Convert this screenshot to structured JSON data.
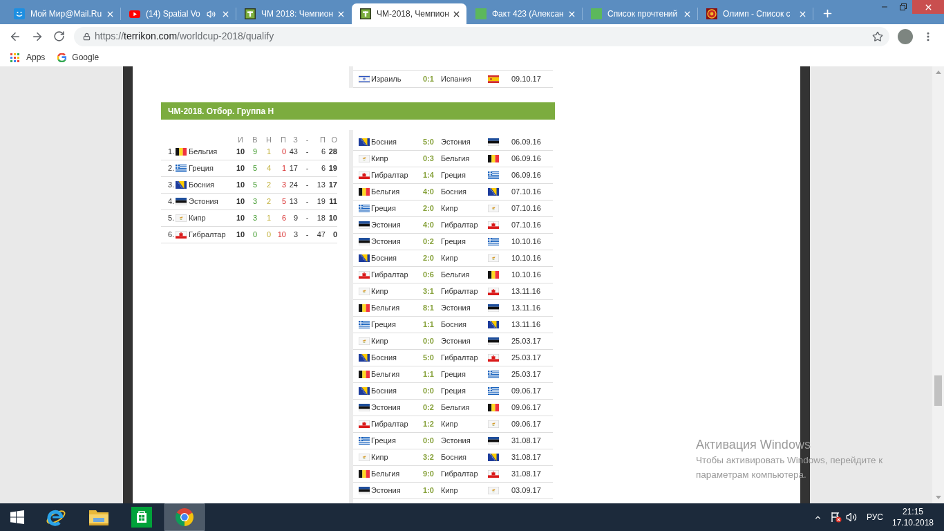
{
  "browser": {
    "tabs": [
      {
        "kind": "mail",
        "title": "Мой Мир@Mail.Ru",
        "audio": false,
        "selected": false
      },
      {
        "kind": "youtube",
        "title": "(14) Spatial Vo",
        "audio": true,
        "selected": false
      },
      {
        "kind": "terrikon",
        "title": "ЧМ 2018: Чемпион",
        "audio": false,
        "selected": false
      },
      {
        "kind": "terrikon",
        "title": "ЧМ-2018, Чемпион",
        "audio": false,
        "selected": true
      },
      {
        "kind": "square",
        "title": "Факт 423 (Алексан",
        "audio": false,
        "selected": false
      },
      {
        "kind": "square",
        "title": "Список прочтений",
        "audio": false,
        "selected": false
      },
      {
        "kind": "emblem",
        "title": "Олимп - Список с",
        "audio": false,
        "selected": false
      }
    ],
    "url": {
      "scheme": "https://",
      "host": "terrikon.com",
      "path": "/worldcup-2018/qualify"
    },
    "bookmarks": [
      {
        "kind": "apps",
        "label": "Apps"
      },
      {
        "kind": "google",
        "label": "Google"
      }
    ]
  },
  "page": {
    "previous_match": {
      "home": {
        "kind": "israel",
        "name": "Израиль"
      },
      "score": "0:1",
      "away": {
        "kind": "spain",
        "name": "Испания"
      },
      "date": "09.10.17"
    },
    "group": {
      "title": "ЧМ-2018. Отбор. Группа Н",
      "standings": {
        "columns": [
          "И",
          "В",
          "Н",
          "П",
          "З",
          "-",
          "П",
          "О"
        ],
        "rows": [
          {
            "rank": "1.",
            "team": {
              "kind": "belgium",
              "name": "Бельгия"
            },
            "played": "10",
            "won": "9",
            "drawn": "1",
            "lost": "0",
            "goals_for": "43",
            "separator": "-",
            "goals_against": "6",
            "points": "28"
          },
          {
            "rank": "2.",
            "team": {
              "kind": "greece",
              "name": "Греция"
            },
            "played": "10",
            "won": "5",
            "drawn": "4",
            "lost": "1",
            "goals_for": "17",
            "separator": "-",
            "goals_against": "6",
            "points": "19"
          },
          {
            "rank": "3.",
            "team": {
              "kind": "bosnia",
              "name": "Босния"
            },
            "played": "10",
            "won": "5",
            "drawn": "2",
            "lost": "3",
            "goals_for": "24",
            "separator": "-",
            "goals_against": "13",
            "points": "17"
          },
          {
            "rank": "4.",
            "team": {
              "kind": "estonia",
              "name": "Эстония"
            },
            "played": "10",
            "won": "3",
            "drawn": "2",
            "lost": "5",
            "goals_for": "13",
            "separator": "-",
            "goals_against": "19",
            "points": "11"
          },
          {
            "rank": "5.",
            "team": {
              "kind": "cyprus",
              "name": "Кипр"
            },
            "played": "10",
            "won": "3",
            "drawn": "1",
            "lost": "6",
            "goals_for": "9",
            "separator": "-",
            "goals_against": "18",
            "points": "10"
          },
          {
            "rank": "6.",
            "team": {
              "kind": "gibraltar",
              "name": "Гибралтар"
            },
            "played": "10",
            "won": "0",
            "drawn": "0",
            "lost": "10",
            "goals_for": "3",
            "separator": "-",
            "goals_against": "47",
            "points": "0"
          }
        ]
      },
      "matches": [
        {
          "home": {
            "kind": "bosnia",
            "name": "Босния"
          },
          "score": "5:0",
          "away": {
            "kind": "estonia",
            "name": "Эстония"
          },
          "date": "06.09.16"
        },
        {
          "home": {
            "kind": "cyprus",
            "name": "Кипр"
          },
          "score": "0:3",
          "away": {
            "kind": "belgium",
            "name": "Бельгия"
          },
          "date": "06.09.16"
        },
        {
          "home": {
            "kind": "gibraltar",
            "name": "Гибралтар"
          },
          "score": "1:4",
          "away": {
            "kind": "greece",
            "name": "Греция"
          },
          "date": "06.09.16"
        },
        {
          "home": {
            "kind": "belgium",
            "name": "Бельгия"
          },
          "score": "4:0",
          "away": {
            "kind": "bosnia",
            "name": "Босния"
          },
          "date": "07.10.16"
        },
        {
          "home": {
            "kind": "greece",
            "name": "Греция"
          },
          "score": "2:0",
          "away": {
            "kind": "cyprus",
            "name": "Кипр"
          },
          "date": "07.10.16"
        },
        {
          "home": {
            "kind": "estonia",
            "name": "Эстония"
          },
          "score": "4:0",
          "away": {
            "kind": "gibraltar",
            "name": "Гибралтар"
          },
          "date": "07.10.16"
        },
        {
          "home": {
            "kind": "estonia",
            "name": "Эстония"
          },
          "score": "0:2",
          "away": {
            "kind": "greece",
            "name": "Греция"
          },
          "date": "10.10.16"
        },
        {
          "home": {
            "kind": "bosnia",
            "name": "Босния"
          },
          "score": "2:0",
          "away": {
            "kind": "cyprus",
            "name": "Кипр"
          },
          "date": "10.10.16"
        },
        {
          "home": {
            "kind": "gibraltar",
            "name": "Гибралтар"
          },
          "score": "0:6",
          "away": {
            "kind": "belgium",
            "name": "Бельгия"
          },
          "date": "10.10.16"
        },
        {
          "home": {
            "kind": "cyprus",
            "name": "Кипр"
          },
          "score": "3:1",
          "away": {
            "kind": "gibraltar",
            "name": "Гибралтар"
          },
          "date": "13.11.16"
        },
        {
          "home": {
            "kind": "belgium",
            "name": "Бельгия"
          },
          "score": "8:1",
          "away": {
            "kind": "estonia",
            "name": "Эстония"
          },
          "date": "13.11.16"
        },
        {
          "home": {
            "kind": "greece",
            "name": "Греция"
          },
          "score": "1:1",
          "away": {
            "kind": "bosnia",
            "name": "Босния"
          },
          "date": "13.11.16"
        },
        {
          "home": {
            "kind": "cyprus",
            "name": "Кипр"
          },
          "score": "0:0",
          "away": {
            "kind": "estonia",
            "name": "Эстония"
          },
          "date": "25.03.17"
        },
        {
          "home": {
            "kind": "bosnia",
            "name": "Босния"
          },
          "score": "5:0",
          "away": {
            "kind": "gibraltar",
            "name": "Гибралтар"
          },
          "date": "25.03.17"
        },
        {
          "home": {
            "kind": "belgium",
            "name": "Бельгия"
          },
          "score": "1:1",
          "away": {
            "kind": "greece",
            "name": "Греция"
          },
          "date": "25.03.17"
        },
        {
          "home": {
            "kind": "bosnia",
            "name": "Босния"
          },
          "score": "0:0",
          "away": {
            "kind": "greece",
            "name": "Греция"
          },
          "date": "09.06.17"
        },
        {
          "home": {
            "kind": "estonia",
            "name": "Эстония"
          },
          "score": "0:2",
          "away": {
            "kind": "belgium",
            "name": "Бельгия"
          },
          "date": "09.06.17"
        },
        {
          "home": {
            "kind": "gibraltar",
            "name": "Гибралтар"
          },
          "score": "1:2",
          "away": {
            "kind": "cyprus",
            "name": "Кипр"
          },
          "date": "09.06.17"
        },
        {
          "home": {
            "kind": "greece",
            "name": "Греция"
          },
          "score": "0:0",
          "away": {
            "kind": "estonia",
            "name": "Эстония"
          },
          "date": "31.08.17"
        },
        {
          "home": {
            "kind": "cyprus",
            "name": "Кипр"
          },
          "score": "3:2",
          "away": {
            "kind": "bosnia",
            "name": "Босния"
          },
          "date": "31.08.17"
        },
        {
          "home": {
            "kind": "belgium",
            "name": "Бельгия"
          },
          "score": "9:0",
          "away": {
            "kind": "gibraltar",
            "name": "Гибралтар"
          },
          "date": "31.08.17"
        },
        {
          "home": {
            "kind": "estonia",
            "name": "Эстония"
          },
          "score": "1:0",
          "away": {
            "kind": "cyprus",
            "name": "Кипр"
          },
          "date": "03.09.17"
        }
      ]
    }
  },
  "activation_notice": {
    "title": "Активация Windows",
    "lines": [
      "Чтобы активировать Windows, перейдите к",
      "параметрам компьютера."
    ]
  },
  "taskbar": {
    "apps": [
      {
        "kind": "browser-e",
        "selected": false
      },
      {
        "kind": "folder",
        "selected": false
      },
      {
        "kind": "store",
        "selected": false
      },
      {
        "kind": "chrome",
        "selected": true
      }
    ],
    "language": "РУС",
    "time": "21:15",
    "date": "17.10.2018"
  }
}
